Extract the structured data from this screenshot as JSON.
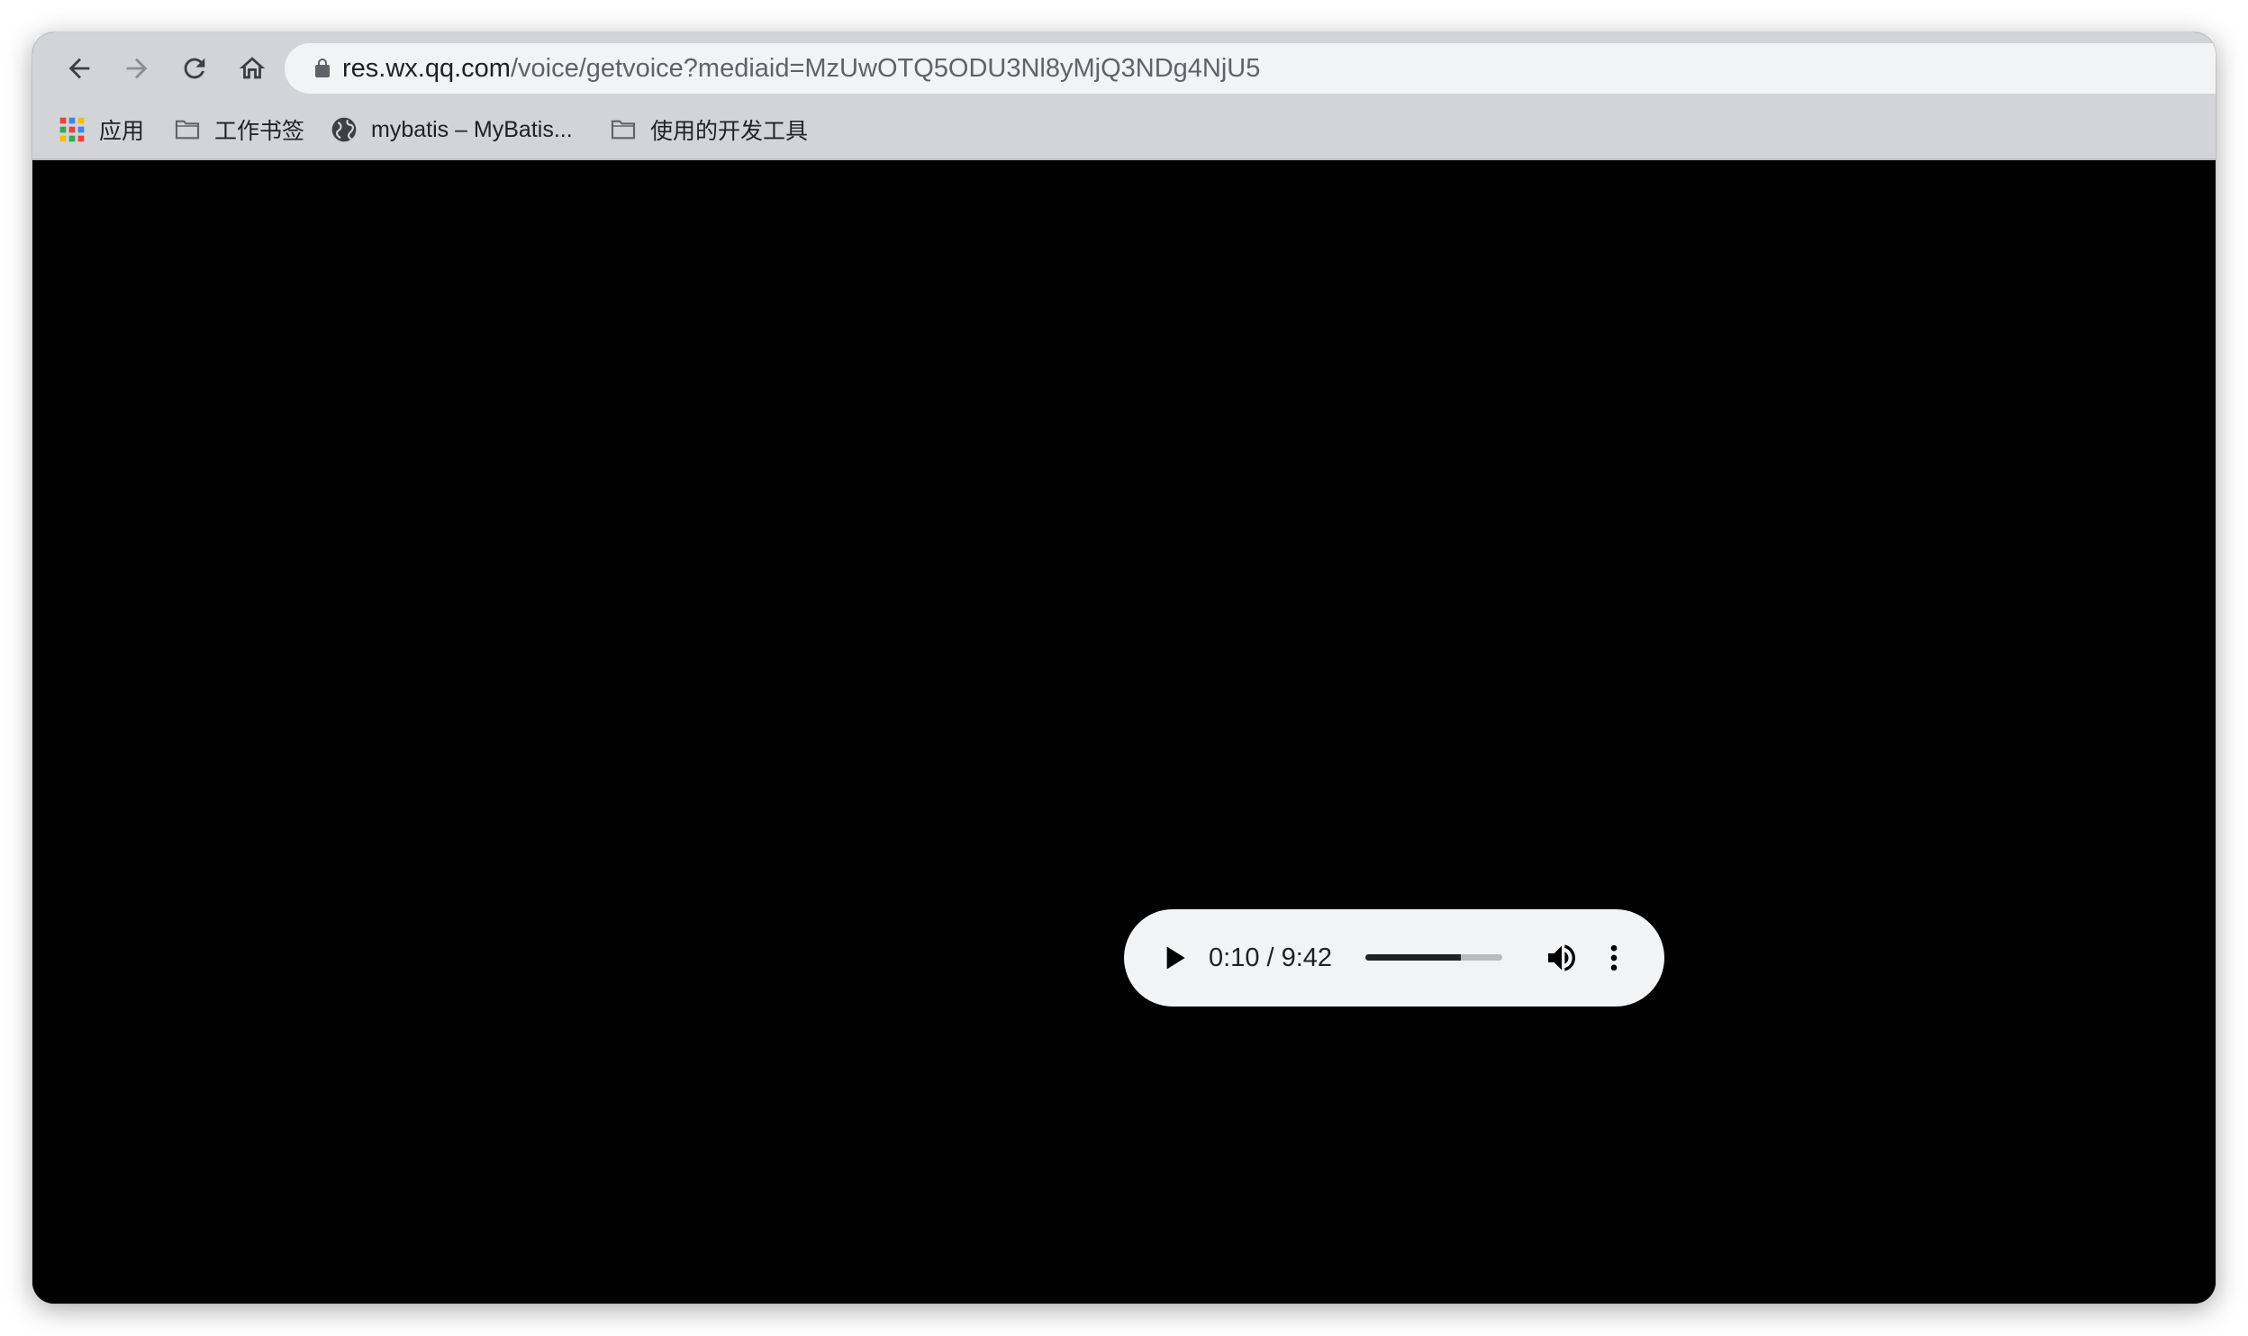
{
  "browser": {
    "url_host": "res.wx.qq.com",
    "url_path": "/voice/getvoice?mediaid=MzUwOTQ5ODU3Nl8yMjQ3NDg4NjU5",
    "nav_icons": [
      "back-arrow-icon",
      "forward-arrow-icon",
      "reload-icon",
      "home-icon"
    ],
    "lock_icon": "lock-icon"
  },
  "bookmarks": [
    {
      "label": "应用",
      "icon": "apps-grid-icon"
    },
    {
      "label": "工作书签",
      "icon": "folder-icon"
    },
    {
      "label": "mybatis – MyBatis...",
      "icon": "globe-icon"
    },
    {
      "label": "使用的开发工具",
      "icon": "folder-icon"
    }
  ],
  "audio_player": {
    "time_display": "0:10 / 9:42",
    "buffered_fraction": 0.7,
    "icons": [
      "play-icon",
      "volume-icon",
      "more-vert-icon"
    ]
  },
  "colors": {
    "toolbar": "#d2d4d8",
    "omnibox": "#f1f3f4",
    "page_background": "#000000",
    "player": "#f1f3f4"
  }
}
